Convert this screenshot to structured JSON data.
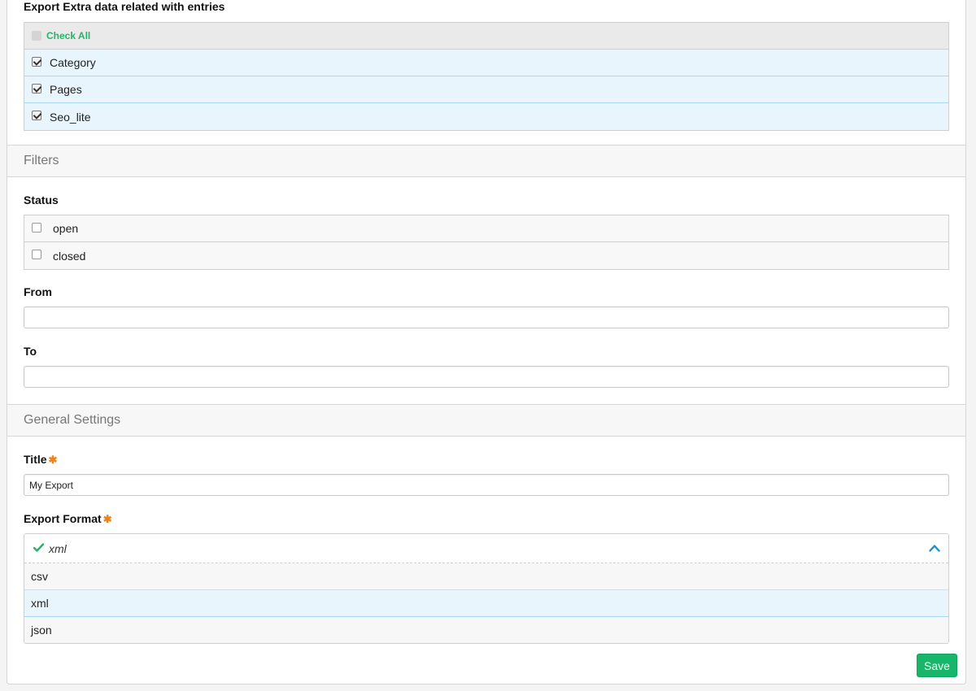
{
  "extra_data": {
    "heading": "Export Extra data related with entries",
    "check_all": "Check All",
    "items": [
      {
        "label": "Category",
        "checked": true
      },
      {
        "label": "Pages",
        "checked": true
      },
      {
        "label": "Seo_lite",
        "checked": true
      }
    ]
  },
  "filters": {
    "section_title": "Filters",
    "status_label": "Status",
    "status_options": [
      {
        "label": "open",
        "checked": false
      },
      {
        "label": "closed",
        "checked": false
      }
    ],
    "from_label": "From",
    "from_value": "",
    "to_label": "To",
    "to_value": ""
  },
  "general": {
    "section_title": "General Settings",
    "title_label": "Title",
    "title_value": "My Export",
    "required_mark": "✱",
    "format_label": "Export Format",
    "format_selected": "xml",
    "format_options": [
      "csv",
      "xml",
      "json"
    ]
  },
  "actions": {
    "save_label": "Save"
  },
  "colors": {
    "accent_green": "#17b66a",
    "required_orange": "#f0811a",
    "selected_row": "#e9f5fd",
    "chevron_blue": "#1e8fd6"
  }
}
